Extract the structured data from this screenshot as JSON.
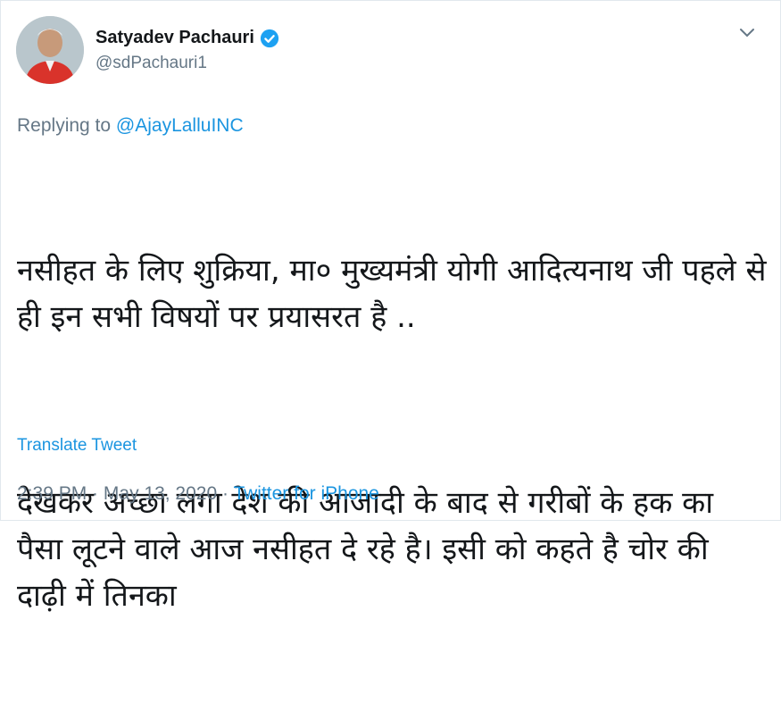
{
  "author": {
    "display_name": "Satyadev Pachauri",
    "handle": "@sdPachauri1",
    "verified": true,
    "avatar_icon": "person-avatar"
  },
  "reply": {
    "prefix": "Replying to",
    "target": "@AjayLalluINC"
  },
  "tweet": {
    "paragraph1": "नसीहत के लिए शुक्रिया, मा० मुख्यमंत्री योगी आदित्यनाथ जी पहले से ही इन सभी विषयों पर प्रयासरत है ..",
    "paragraph2": "देखकर अच्छा लगा देश की आजादी के बाद से गरीबों के हक का पैसा लूटने वाले आज नसीहत दे रहे है। इसी को कहते है चोर की दाढ़ी में तिनका"
  },
  "translate_label": "Translate Tweet",
  "meta": {
    "time": "2:39 PM",
    "separator": " · ",
    "date": "May 13, 2020",
    "source": "Twitter for iPhone"
  },
  "colors": {
    "link": "#1b95e0",
    "secondary": "#657786",
    "text": "#14171a",
    "verified": "#1da1f2"
  }
}
